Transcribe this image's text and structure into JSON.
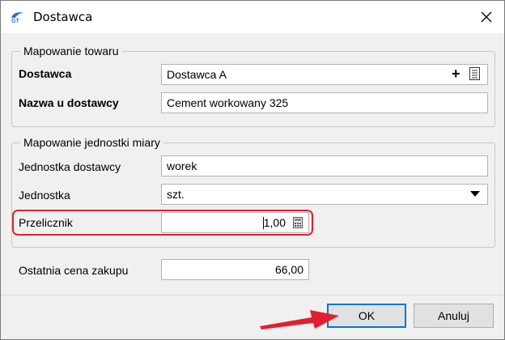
{
  "window": {
    "title": "Dostawca",
    "close_label": "✕"
  },
  "mapping_goods": {
    "legend": "Mapowanie towaru",
    "supplier_label": "Dostawca",
    "supplier_value": "Dostawca A",
    "supplier_add_glyph": "+",
    "name_label": "Nazwa u dostawcy",
    "name_value": "Cement workowany 325"
  },
  "mapping_unit": {
    "legend": "Mapowanie jednostki miary",
    "supplier_unit_label": "Jednostka dostawcy",
    "supplier_unit_value": "worek",
    "unit_label": "Jednostka",
    "unit_value": "szt.",
    "converter_label": "Przelicznik",
    "converter_value": "1,00"
  },
  "last_price": {
    "label": "Ostatnia cena zakupu",
    "value": "66,00"
  },
  "buttons": {
    "ok": "OK",
    "cancel": "Anuluj"
  },
  "colors": {
    "highlight": "#e0202e",
    "arrow": "#e0202e",
    "accent": "#0078d7"
  }
}
